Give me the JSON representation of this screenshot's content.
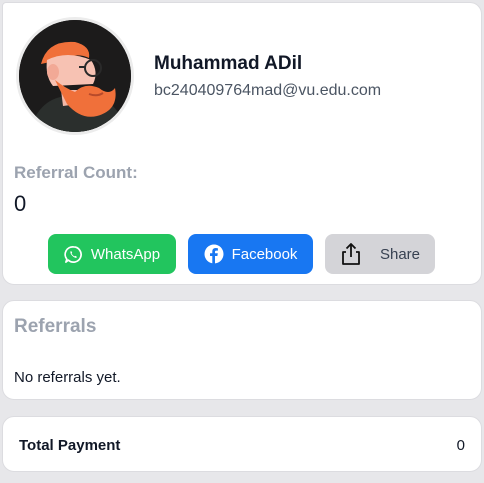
{
  "profile": {
    "name": "Muhammad ADil",
    "email": "bc240409764mad@vu.edu.com",
    "avatar_icon": "user-avatar-illustration"
  },
  "referral": {
    "count_label": "Referral Count:",
    "count": "0"
  },
  "share_buttons": {
    "whatsapp": {
      "label": "WhatsApp",
      "icon": "whatsapp-icon",
      "color": "#22c55e"
    },
    "facebook": {
      "label": "Facebook",
      "icon": "facebook-icon",
      "color": "#1877f2"
    },
    "share": {
      "label": "Share",
      "icon": "share-icon",
      "color": "#d4d4d8"
    }
  },
  "referrals_section": {
    "title": "Referrals",
    "empty_text": "No referrals yet."
  },
  "total_payment": {
    "label": "Total Payment",
    "value": "0"
  }
}
